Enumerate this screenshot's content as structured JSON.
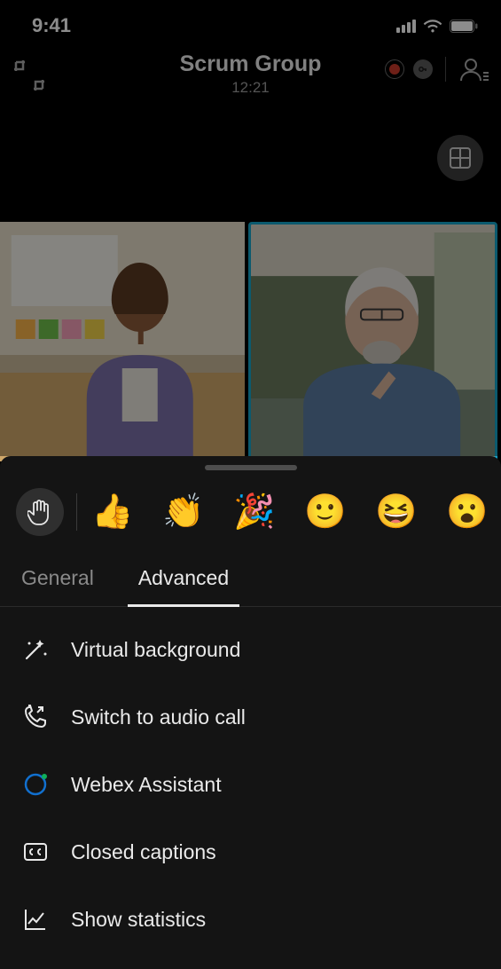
{
  "status": {
    "time": "9:41"
  },
  "call": {
    "title": "Scrum Group",
    "duration": "12:21"
  },
  "reactions": {
    "items": [
      "👍",
      "👏",
      "🎉",
      "🙂",
      "😆",
      "😮"
    ]
  },
  "tabs": {
    "general": "General",
    "advanced": "Advanced",
    "active": "advanced"
  },
  "menu": {
    "virtual_bg": "Virtual background",
    "audio_call": "Switch to audio call",
    "assistant": "Webex Assistant",
    "captions": "Closed captions",
    "stats": "Show statistics"
  }
}
